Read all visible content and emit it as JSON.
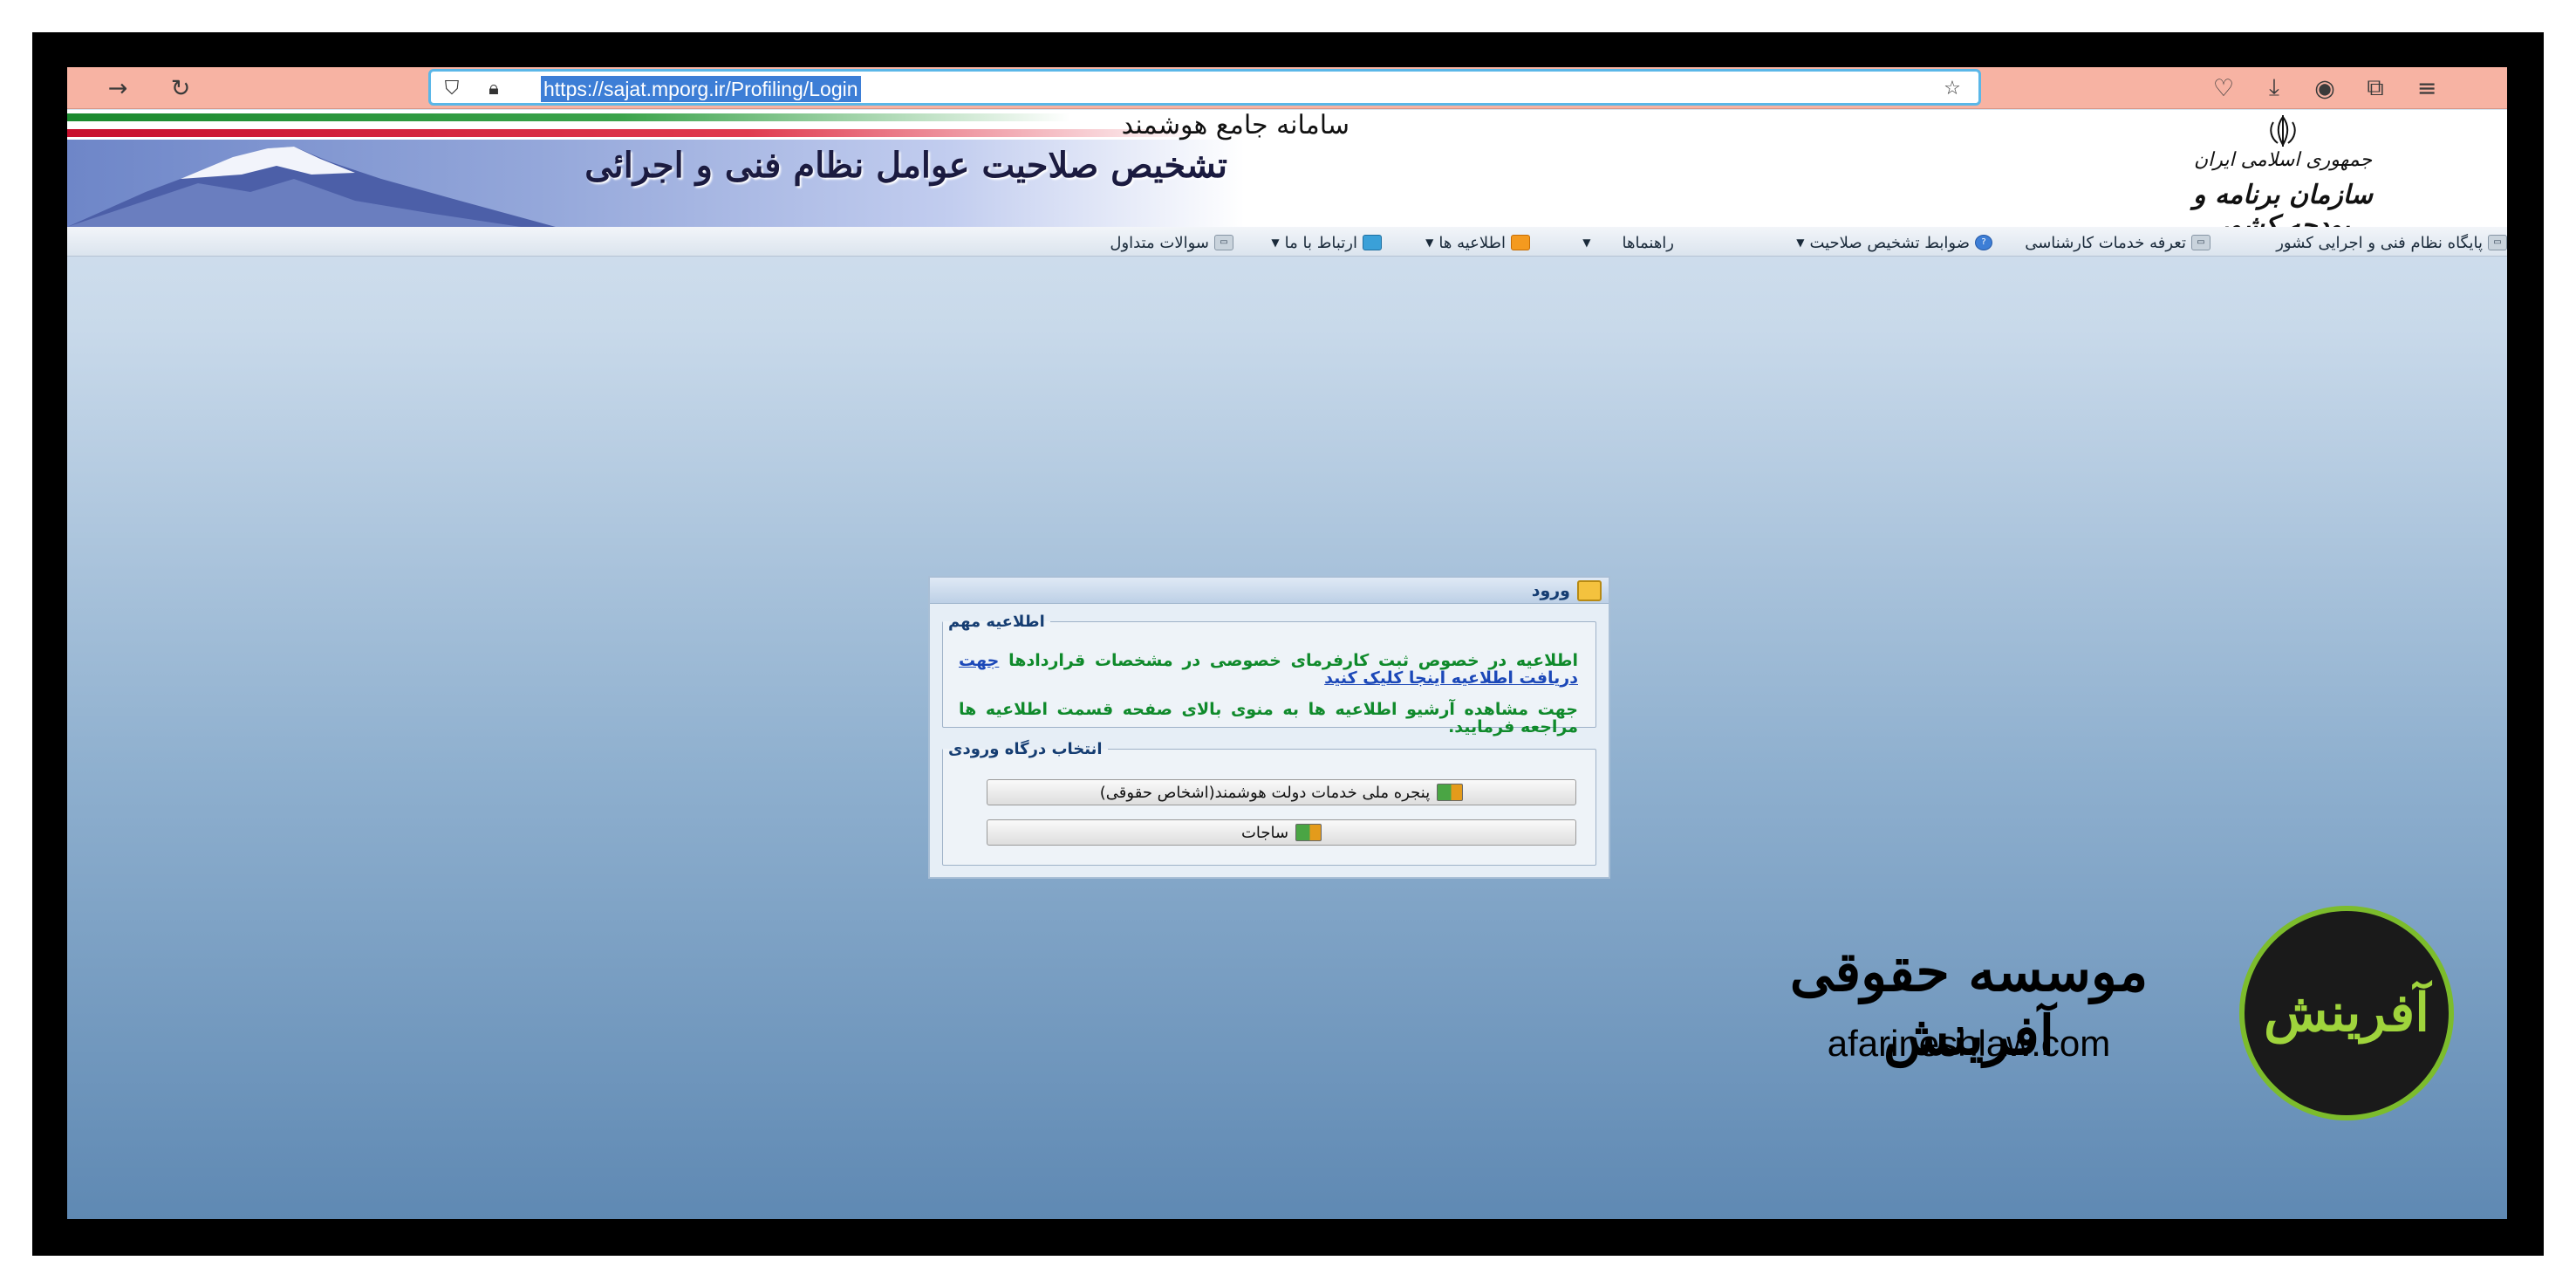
{
  "browser": {
    "url": "https://sajat.mporg.ir/Profiling/Login",
    "icons": [
      "back-arrow-icon",
      "reload-icon",
      "shield-icon",
      "lock-icon",
      "star-icon",
      "pocket-icon",
      "download-icon",
      "account-icon",
      "extensions-icon",
      "menu-icon"
    ]
  },
  "header": {
    "subtitle": "سامانه جامع هوشمند",
    "title": "تشخیص صلاحیت عوامل نظام فنی و اجرائی",
    "org_line1": "جمهوری اسلامی ایران",
    "org_line2": "سازمان برنامه و بودجه کشور"
  },
  "menu": {
    "items": [
      {
        "label": "پایگاه نظام فنی و اجرایی کشور",
        "icon": "link-icon"
      },
      {
        "label": "تعرفه خدمات کارشناسی",
        "icon": "link-icon"
      },
      {
        "label": "ضوابط تشخیص صلاحیت",
        "icon": "help-icon"
      },
      {
        "label": "راهنماها",
        "icon": ""
      },
      {
        "label": "اطلاعیه ها",
        "icon": "rss-icon"
      },
      {
        "label": "ارتباط با ما",
        "icon": "contact-icon"
      },
      {
        "label": "سوالات متداول",
        "icon": "link-icon"
      }
    ]
  },
  "login": {
    "title": "ورود",
    "notice_legend": "اطلاعیه مهم",
    "notice1": "اطلاعیه در خصوص ثبت کارفرمای خصوصی در مشخصات قراردادها",
    "notice1_link": "جهت دریافت اطلاعیه اینجا کلیک کنید",
    "notice2": "جهت مشاهده آرشیو اطلاعیه ها به منوی بالای صفحه قسمت اطلاعیه ها مراجعه فرمایید.",
    "portal_legend": "انتخاب درگاه ورودی",
    "btn_national": "پنجره ملی خدمات دولت هوشمند(اشخاص حقوقی)",
    "btn_sajat": "ساجات"
  },
  "watermark": {
    "logo_text": "آفرینش",
    "title": "موسسه حقوقی آفرینش",
    "url": "afarineshlaw.com",
    "accent": "#7cbc2c"
  }
}
